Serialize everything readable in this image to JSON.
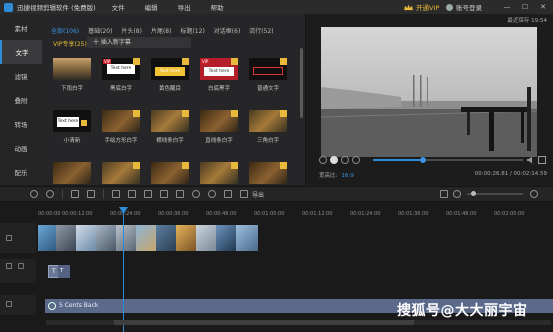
{
  "window": {
    "title": "迅捷视频剪辑软件 (免费版)",
    "menu": [
      "文件",
      "编辑",
      "导出",
      "帮助"
    ],
    "vip_label": "开通VIP",
    "login_label": "账号登录",
    "controls": [
      "—",
      "☐",
      "✕"
    ],
    "accent": "#2e8bd6"
  },
  "sidebar": {
    "items": [
      {
        "label": "素材",
        "active": false
      },
      {
        "label": "文字",
        "active": true
      },
      {
        "label": "滤镜",
        "active": false
      },
      {
        "label": "叠附",
        "active": false
      },
      {
        "label": "转场",
        "active": false
      },
      {
        "label": "动画",
        "active": false
      },
      {
        "label": "配乐",
        "active": false
      }
    ]
  },
  "library": {
    "tabs": [
      "全部(106)",
      "基础(20)",
      "片头(8)",
      "片尾(8)",
      "标题(12)",
      "对话框(6)",
      "流行(52)"
    ],
    "vip_tag": "VIP专享(25)",
    "insert_button": "十 插入新字幕",
    "tiles": [
      {
        "label": "下雨白字",
        "text": ""
      },
      {
        "label": "黑底白字",
        "text": "Text here",
        "vip": "VIP"
      },
      {
        "label": "黄色醒目",
        "text": "Text here"
      },
      {
        "label": "白底黑字",
        "text": "Text here",
        "vip": "VIP"
      },
      {
        "label": "普通文字",
        "text": ""
      },
      {
        "label": "小清新",
        "text": "Text here"
      },
      {
        "label": "手绘方形白字",
        "text": ""
      },
      {
        "label": "横线条白字",
        "text": ""
      },
      {
        "label": "直线条白字",
        "text": ""
      },
      {
        "label": "三角白字",
        "text": ""
      }
    ]
  },
  "player": {
    "autosave": "最近保存 19:54",
    "aspect_label": "宽高比:",
    "aspect_value": "16:9",
    "time": "00:00:26.81 / 00:02:14.59",
    "progress": 0.33
  },
  "toolbar": {
    "export_label": "导出"
  },
  "timeline": {
    "ruler": [
      "00:00:00",
      "00:00:12.00",
      "00:00:24.00",
      "00:00:36.00",
      "00:00:48.00",
      "00:01:00.00",
      "00:01:12.00",
      "00:01:24.00",
      "00:01:36.00",
      "00:01:48.00",
      "00:02:00.00"
    ],
    "text_track_label": "T",
    "text_clip_label": "T",
    "audio_clip": "5 Cents Back"
  },
  "watermark": "搜狐号@大大丽宇宙"
}
